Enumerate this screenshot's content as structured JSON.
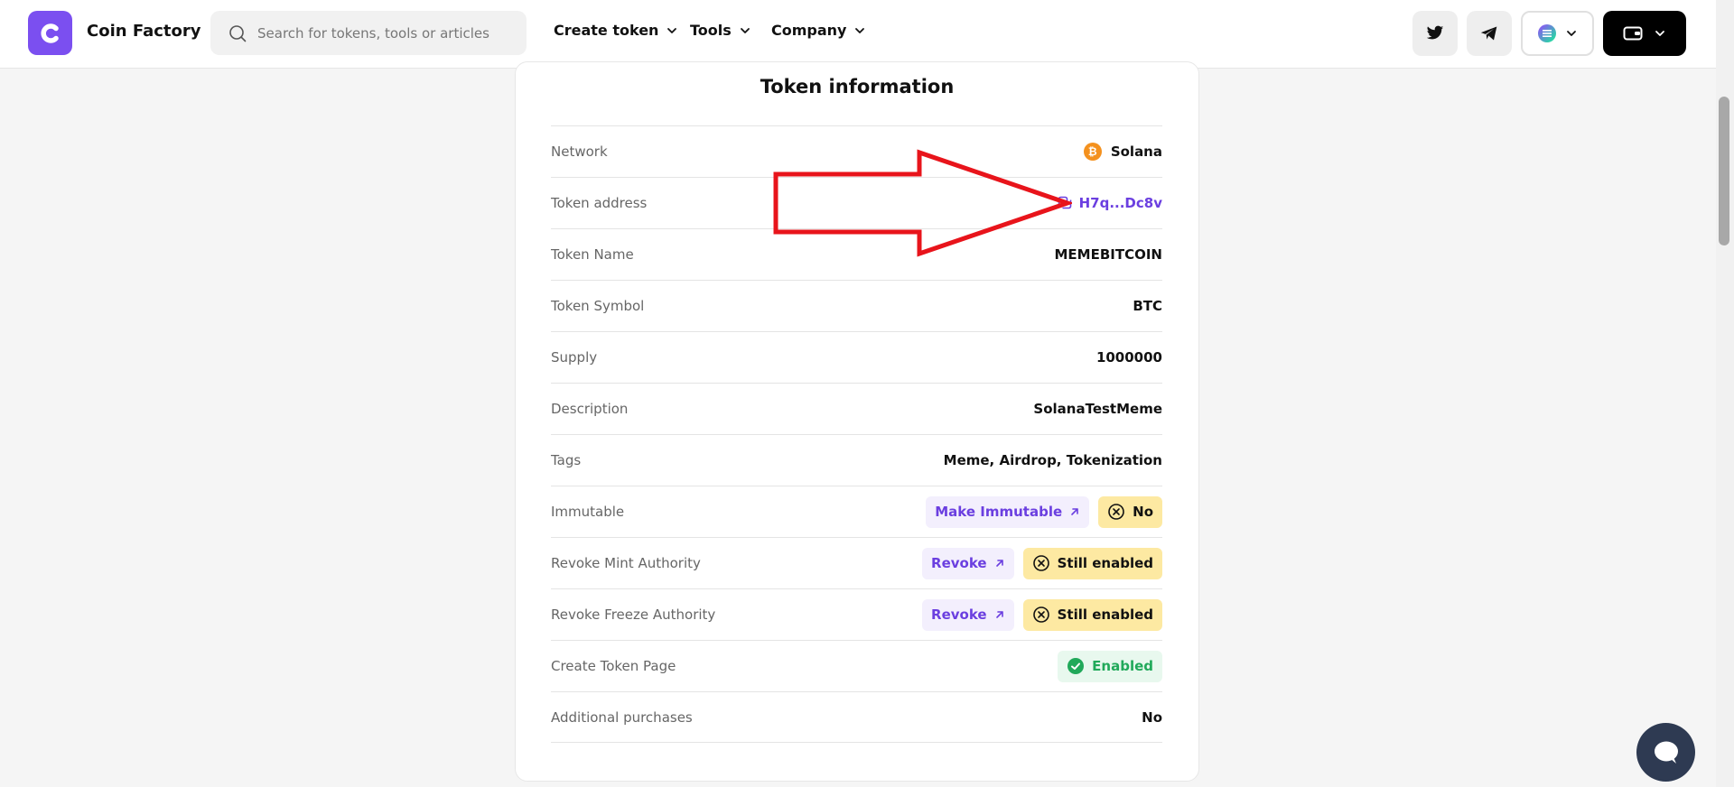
{
  "header": {
    "brand": "Coin Factory",
    "search_placeholder": "Search for tokens, tools or articles",
    "nav": {
      "create_token": "Create token",
      "tools": "Tools",
      "company": "Company"
    }
  },
  "card": {
    "title": "Token information",
    "rows": {
      "network": {
        "label": "Network",
        "value": "Solana"
      },
      "token_address": {
        "label": "Token address",
        "value": "H7q...Dc8v"
      },
      "token_name": {
        "label": "Token Name",
        "value": "MEMEBITCOIN"
      },
      "token_symbol": {
        "label": "Token Symbol",
        "value": "BTC"
      },
      "supply": {
        "label": "Supply",
        "value": "1000000"
      },
      "description": {
        "label": "Description",
        "value": "SolanaTestMeme"
      },
      "tags": {
        "label": "Tags",
        "value": "Meme, Airdrop, Tokenization"
      },
      "immutable": {
        "label": "Immutable",
        "action": "Make Immutable",
        "status": "No"
      },
      "revoke_mint": {
        "label": "Revoke Mint Authority",
        "action": "Revoke",
        "status": "Still enabled"
      },
      "revoke_freeze": {
        "label": "Revoke Freeze Authority",
        "action": "Revoke",
        "status": "Still enabled"
      },
      "create_token_page": {
        "label": "Create Token Page",
        "status": "Enabled"
      },
      "additional_purchases": {
        "label": "Additional purchases",
        "value": "No"
      }
    }
  },
  "colors": {
    "brand": "#7b4ff0",
    "link": "#6b3fe0",
    "warning_bg": "#fde9a2",
    "success": "#21a95a",
    "annotation_arrow": "#e8141b"
  },
  "icons": [
    "coin-factory-logo-icon",
    "search-icon",
    "chevron-down-icon",
    "twitter-icon",
    "telegram-icon",
    "solana-icon",
    "wallet-icon",
    "bitcoin-coin-icon",
    "copy-icon",
    "external-link-icon",
    "x-circle-icon",
    "check-circle-icon",
    "chat-icon"
  ]
}
